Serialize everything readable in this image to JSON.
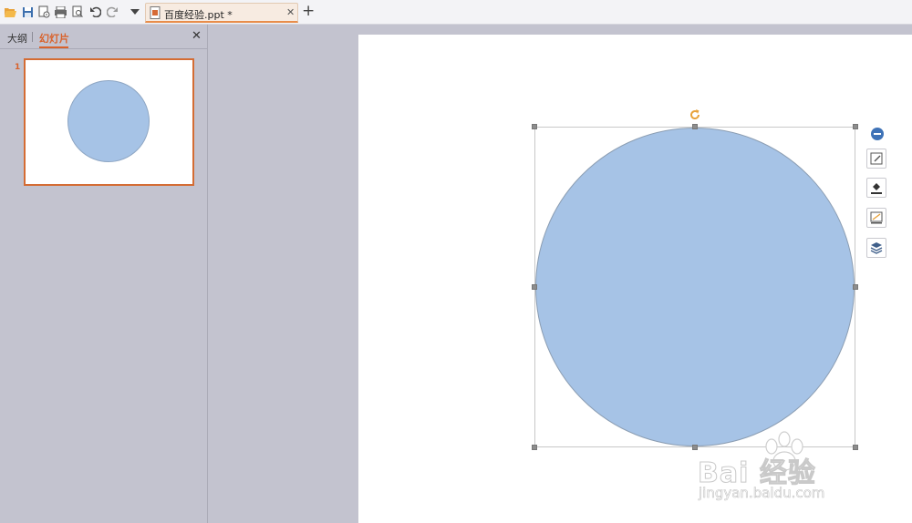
{
  "quick_access": {
    "icons": [
      "open-folder-icon",
      "save-icon",
      "save-as-icon",
      "print-icon",
      "print-preview-icon",
      "undo-icon",
      "redo-icon",
      "dropdown-arrow-icon"
    ]
  },
  "tab": {
    "title": "百度经验.ppt *",
    "close_glyph": "✕"
  },
  "add_tab_glyph": "+",
  "left_panel": {
    "tab_outline": "大纲",
    "tab_slides": "幻灯片",
    "close_glyph": "✕",
    "slide_number": "1"
  },
  "shape": {
    "fill_color": "#a6c3e6",
    "stroke_color": "#8b9db2",
    "rotate_icon": "rotate-icon"
  },
  "float_toolbar": {
    "items": [
      "collapse-minus-icon",
      "edit-shape-icon",
      "fill-bucket-icon",
      "outline-icon",
      "layers-icon"
    ]
  },
  "watermark": {
    "brand": "Bai 经验",
    "url": "jingyan.baidu.com"
  },
  "colors": {
    "accent": "#d9622b",
    "thumb_border": "#d46c34",
    "minus_button": "#3f73b7"
  }
}
